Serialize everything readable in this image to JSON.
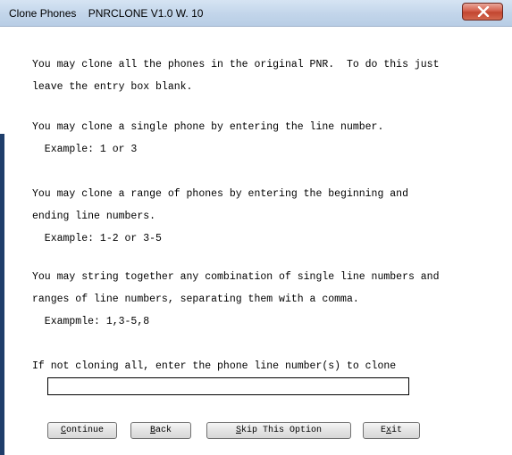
{
  "window": {
    "title": "Clone Phones    PNRCLONE V1.0 W. 10",
    "close_icon": "close-x-icon"
  },
  "instructions": {
    "all": "You may clone all the phones in the original PNR.  To do this just\nleave the entry box blank.",
    "single": "You may clone a single phone by entering the line number.\n  Example: 1 or 3",
    "range": "You may clone a range of phones by entering the beginning and\nending line numbers.\n  Example: 1-2 or 3-5",
    "combo": "You may string together any combination of single line numbers and\nranges of line numbers, separating them with a comma.\n  Exampmle: 1,3-5,8"
  },
  "entry": {
    "prompt": "If not cloning all, enter the phone line number(s) to clone",
    "value": ""
  },
  "buttons": {
    "continue": {
      "pre": "",
      "key": "C",
      "post": "ontinue"
    },
    "back": {
      "pre": "",
      "key": "B",
      "post": "ack"
    },
    "skip": {
      "pre": "",
      "key": "S",
      "post": "kip This Option"
    },
    "exit": {
      "pre": "E",
      "key": "x",
      "post": "it"
    }
  },
  "colors": {
    "titlebar": "#c2d5ea",
    "close_button": "#c24630",
    "accent": "#1f3e6b"
  }
}
